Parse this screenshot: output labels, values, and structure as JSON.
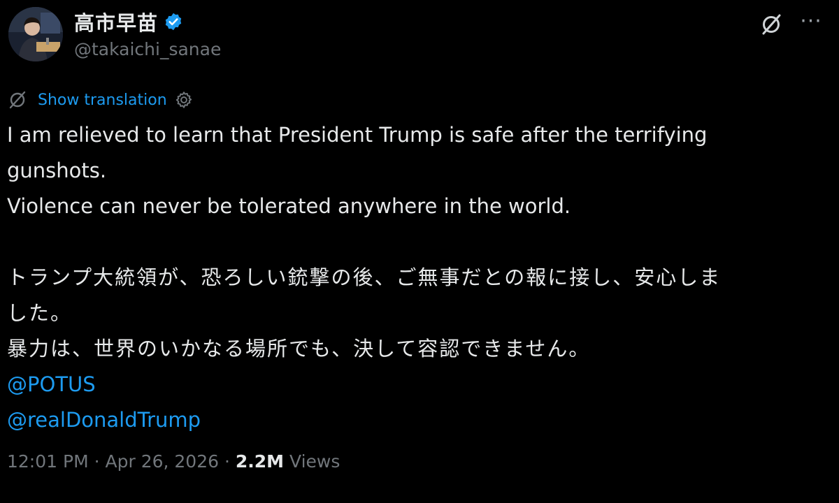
{
  "author": {
    "display_name": "高市早苗",
    "handle": "@takaichi_sanae",
    "verified": true
  },
  "translate": {
    "label": "Show translation"
  },
  "tweet": {
    "lines_en": [
      "I am relieved to learn that President Trump is safe after the terrifying",
      "gunshots.",
      "Violence can never be tolerated anywhere in the world."
    ],
    "lines_jp": [
      "トランプ大統領が、恐ろしい銃撃の後、ご無事だとの報に接し、安心しま",
      "した。",
      "暴力は、世界のいかなる場所でも、決して容認できません。"
    ],
    "mentions": [
      "@POTUS",
      "@realDonaldTrump"
    ]
  },
  "meta": {
    "time": "12:01 PM",
    "date": "Apr 26, 2026",
    "separator": "·",
    "views_count": "2.2M",
    "views_label": "Views"
  },
  "icons": {
    "verified": "verified-badge-icon",
    "grok": "grok-icon",
    "more": "more-options-icon",
    "settings": "gear-icon"
  },
  "colors": {
    "background": "#000000",
    "text": "#e7e9ea",
    "secondary": "#71767b",
    "link": "#1d9bf0"
  }
}
